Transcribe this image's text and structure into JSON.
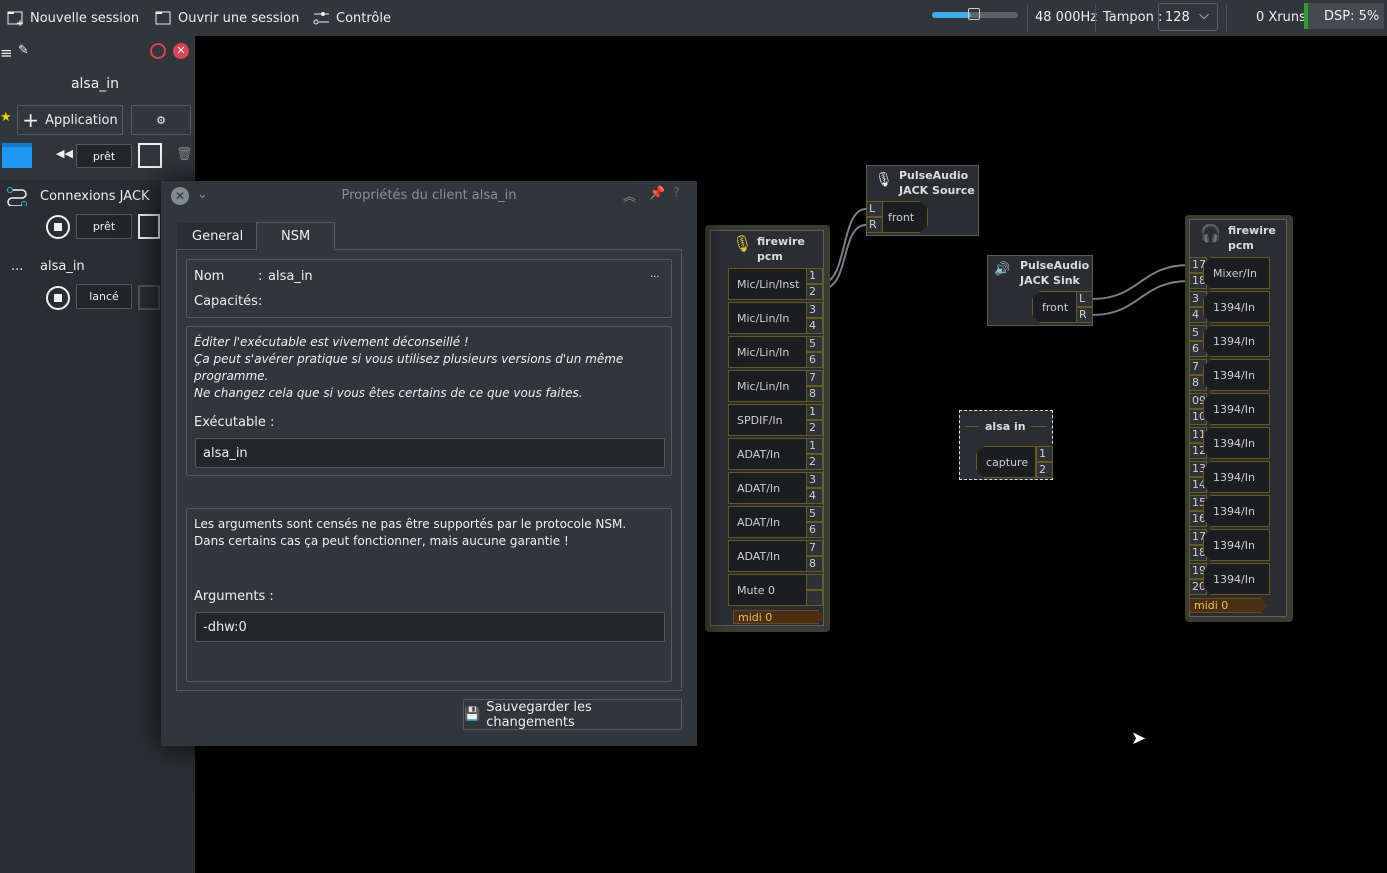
{
  "toolbar": {
    "new_session": "Nouvelle session",
    "open_session": "Ouvrir une session",
    "control": "Contrôle",
    "samplerate": "48 000Hz",
    "buffer_label": "Tampon :",
    "buffer_value": "128",
    "xruns": "0 Xruns",
    "dsp": "DSP: 5%",
    "volume_fraction": 0.45,
    "dsp_color": "#2ca02c"
  },
  "session": {
    "name": "alsa_in",
    "add_app": "Application",
    "status": "prêt",
    "clients": [
      {
        "name": "Connexions JACK",
        "status": "prêt"
      },
      {
        "name": "alsa_in",
        "status": "lancé",
        "prefix": "..."
      }
    ]
  },
  "dialog": {
    "title": "Propriétés du client alsa_in",
    "tabs": [
      "General",
      "NSM"
    ],
    "active_tab": "NSM",
    "nom_label": "Nom",
    "nom_value": "alsa_in",
    "cap_label": "Capacités",
    "sep": ":",
    "more": "...",
    "warn1": "Éditer l'exécutable est vivement déconseillé !",
    "warn2": "Ça peut s'avérer pratique si vous utilisez plusieurs versions d'un même programme.",
    "warn3": "Ne changez cela que si vous êtes certains de ce que vous faites.",
    "exec_label": "Exécutable :",
    "exec_value": "alsa_in",
    "args1": "Les arguments sont censés ne pas être supportés par le protocole NSM.",
    "args2": "Dans certains cas ça peut fonctionner, mais aucune garantie !",
    "args_label": "Arguments :",
    "args_value": "-dhw:0",
    "save": "Sauvegarder les changements"
  },
  "canvas": {
    "capture": {
      "title1": "firewire",
      "title2": "pcm",
      "ports": [
        {
          "label": "Mic/Lin/Inst",
          "n": [
            "1",
            "2"
          ]
        },
        {
          "label": "Mic/Lin/In",
          "n": [
            "3",
            "4"
          ]
        },
        {
          "label": "Mic/Lin/In",
          "n": [
            "5",
            "6"
          ]
        },
        {
          "label": "Mic/Lin/In",
          "n": [
            "7",
            "8"
          ]
        },
        {
          "label": "SPDIF/In",
          "n": [
            "1",
            "2"
          ]
        },
        {
          "label": "ADAT/In",
          "n": [
            "1",
            "2"
          ]
        },
        {
          "label": "ADAT/In",
          "n": [
            "3",
            "4"
          ]
        },
        {
          "label": "ADAT/In",
          "n": [
            "5",
            "6"
          ]
        },
        {
          "label": "ADAT/In",
          "n": [
            "7",
            "8"
          ]
        },
        {
          "label": "Mute 0",
          "n": [
            "",
            ""
          ]
        }
      ],
      "midi": "midi 0"
    },
    "playback": {
      "title1": "firewire",
      "title2": "pcm",
      "ports": [
        {
          "label": "Mixer/In",
          "n": [
            "17",
            "18"
          ]
        },
        {
          "label": "1394/In",
          "n": [
            "3",
            "4"
          ]
        },
        {
          "label": "1394/In",
          "n": [
            "5",
            "6"
          ]
        },
        {
          "label": "1394/In",
          "n": [
            "7",
            "8"
          ]
        },
        {
          "label": "1394/In",
          "n": [
            "09",
            "10"
          ]
        },
        {
          "label": "1394/In",
          "n": [
            "11",
            "12"
          ]
        },
        {
          "label": "1394/In",
          "n": [
            "13",
            "14"
          ]
        },
        {
          "label": "1394/In",
          "n": [
            "15",
            "16"
          ]
        },
        {
          "label": "1394/In",
          "n": [
            "17",
            "18"
          ]
        },
        {
          "label": "1394/In",
          "n": [
            "19",
            "20"
          ]
        }
      ],
      "midi": "midi 0"
    },
    "source": {
      "title1": "PulseAudio",
      "title2": "JACK Source",
      "port": "front",
      "n": [
        "L",
        "R"
      ]
    },
    "sink": {
      "title1": "PulseAudio",
      "title2": "JACK Sink",
      "port": "front",
      "n": [
        "L",
        "R"
      ]
    },
    "alsa": {
      "title": "alsa in",
      "port": "capture",
      "n": [
        "1",
        "2"
      ]
    }
  }
}
